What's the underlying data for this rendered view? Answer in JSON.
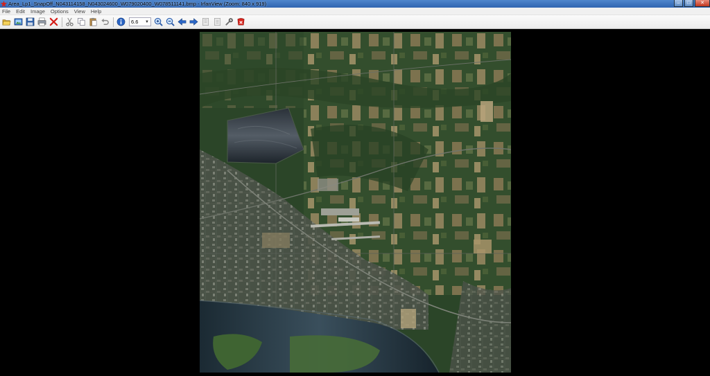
{
  "window": {
    "title": "Area_Lp1_SnapOff_N043114158_N043024600_W079020400_W078511141.bmp - IrfanView (Zoom: 840 x 919)",
    "controls": [
      "minimize",
      "maximize",
      "close"
    ]
  },
  "menu": {
    "items": [
      "File",
      "Edit",
      "Image",
      "Options",
      "View",
      "Help"
    ]
  },
  "toolbar": {
    "zoom_value": "6.6",
    "buttons": [
      {
        "name": "open-folder-icon"
      },
      {
        "name": "slideshow-icon"
      },
      {
        "name": "save-icon"
      },
      {
        "name": "print-icon"
      },
      {
        "name": "delete-icon"
      },
      {
        "name": "cut-icon"
      },
      {
        "name": "copy-icon"
      },
      {
        "name": "paste-icon"
      },
      {
        "name": "undo-icon"
      },
      {
        "name": "info-icon"
      },
      {
        "name": "zoom-in-icon"
      },
      {
        "name": "zoom-out-icon"
      },
      {
        "name": "previous-icon"
      },
      {
        "name": "next-icon"
      },
      {
        "name": "first-page-icon"
      },
      {
        "name": "last-page-icon"
      },
      {
        "name": "settings-icon"
      },
      {
        "name": "exit-icon"
      }
    ]
  },
  "colors": {
    "title_bar": "#3a70bb",
    "background": "#000000",
    "map_green": "#2f4a2a",
    "water": "#1c2a33"
  },
  "image": {
    "content": "aerial-satellite-photo"
  }
}
